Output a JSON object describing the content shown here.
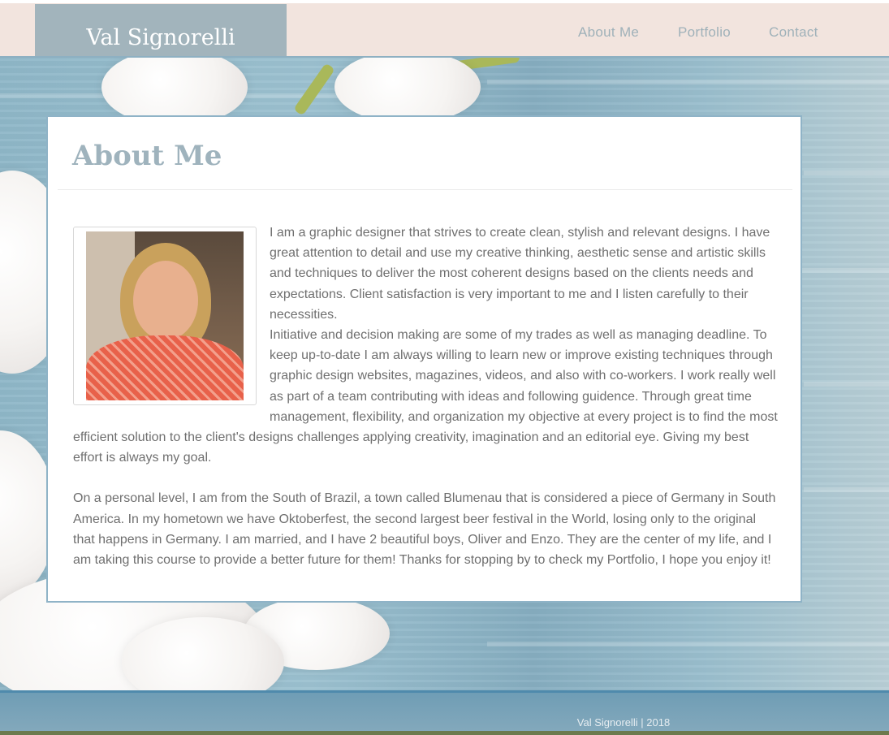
{
  "site": {
    "logo": "Val Signorelli"
  },
  "nav": {
    "items": [
      "About Me",
      "Portfolio",
      "Contact"
    ]
  },
  "about": {
    "title": "About Me",
    "photo_alt": "Portrait of Val Signorelli",
    "paragraph1_a": "I am a graphic designer that strives to create clean, stylish and relevant designs. I have great attention to detail and use my creative thinking, aesthetic sense and artistic skills and techniques to deliver the most coherent designs based on the clients needs and expectations. Client satisfaction is very important to me and I listen carefully to their necessities.",
    "paragraph1_b": "Initiative and decision making are some of my trades as well as managing deadline. To keep up-to-date I am always willing to learn new or improve existing techniques through graphic design websites, magazines, videos, and also with co-workers. I work really well as part of a team contributing with ideas and following guidence. Through great time management, flexibility, and organization my objective at every project is to find the most efficient solution to the client's designs challenges applying creativity, imagination and an editorial eye. Giving my best effort is always my goal.",
    "paragraph2": "On a personal level, I am from the South of Brazil, a town called Blumenau that is considered a piece of Germany in South America. In my hometown we have Oktoberfest, the second largest beer festival in the World, losing only to the original that happens in Germany. I am married, and I have 2 beautiful boys, Oliver and Enzo. They are the center of my life, and I am taking this course to provide a better future for them! Thanks for stopping by to check my Portfolio, I hope you enjoy it!"
  },
  "footer": {
    "text": "Val Signorelli | 2018"
  },
  "colors": {
    "header_bg": "#f2e4de",
    "logo_bg": "#a2b4bc",
    "nav_text": "#9fb1b9",
    "title_text": "#9fb3bd",
    "body_text": "#6f6f6f",
    "card_border": "#8fb3c7",
    "footer_bg": "#7ba4b9"
  }
}
